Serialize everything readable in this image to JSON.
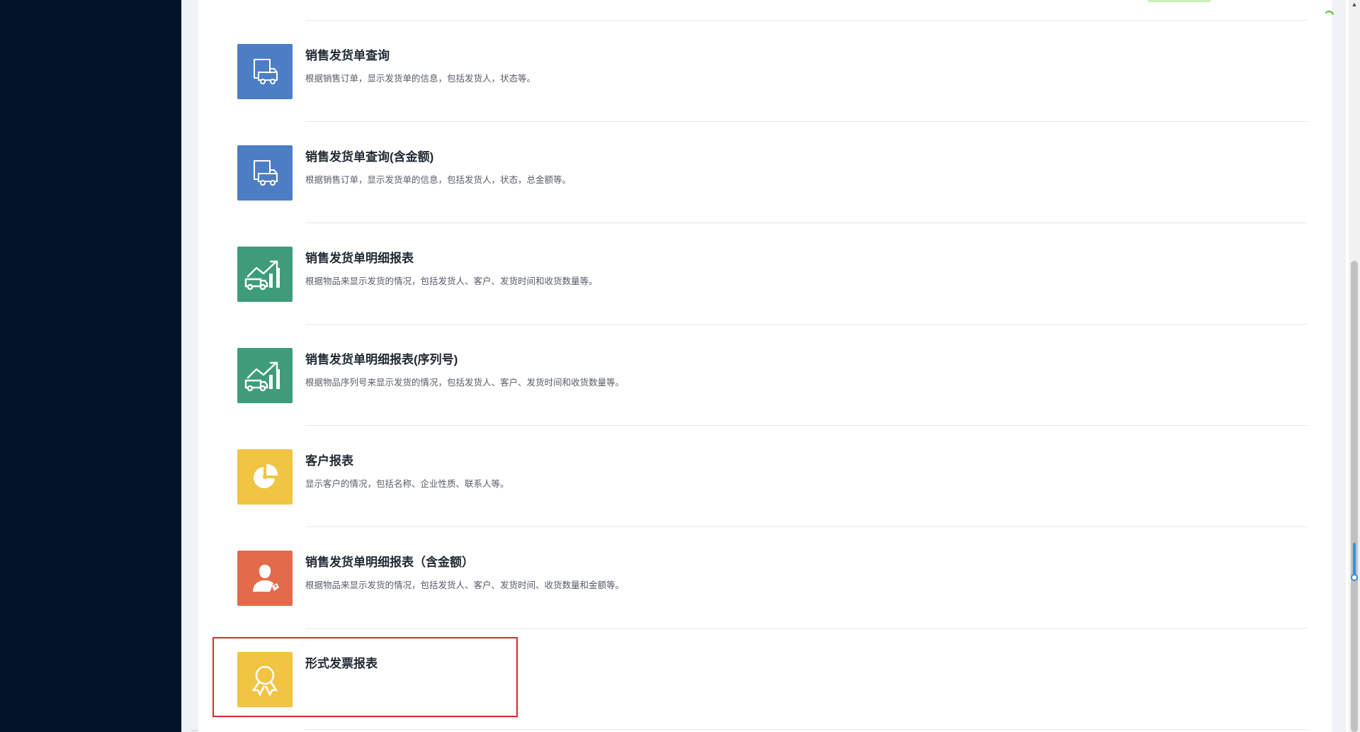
{
  "reports": [
    {
      "title": "销售发货单查询",
      "description": "根据销售订单，显示发货单的信息，包括发货人，状态等。",
      "icon": "delivery-truck-icon",
      "color": "#4d7ec5"
    },
    {
      "title": "销售发货单查询(含金额)",
      "description": "根据销售订单，显示发货单的信息，包括发货人，状态，总金额等。",
      "icon": "delivery-truck-icon",
      "color": "#4d7ec5"
    },
    {
      "title": "销售发货单明细报表",
      "description": "根据物品来显示发货的情况，包括发货人、客户、发货时间和收货数量等。",
      "icon": "truck-growth-chart-icon",
      "color": "#3f9c7a"
    },
    {
      "title": "销售发货单明细报表(序列号)",
      "description": "根据物品序列号来显示发货的情况，包括发货人、客户、发货时间和收货数量等。",
      "icon": "truck-growth-chart-icon",
      "color": "#3f9c7a"
    },
    {
      "title": "客户报表",
      "description": "显示客户的情况，包括名称、企业性质、联系人等。",
      "icon": "pie-chart-icon",
      "color": "#f1c443"
    },
    {
      "title": "销售发货单明细报表（含金额）",
      "description": "根据物品来显示发货的情况，包括发货人、客户、发货时间、收货数量和金额等。",
      "icon": "user-tag-icon",
      "color": "#e46a4c"
    },
    {
      "title": "形式发票报表",
      "description": "",
      "icon": "award-ribbon-icon",
      "color": "#f1c443"
    }
  ],
  "colors": {
    "sidebar": "#021429",
    "highlight": "#e2252c",
    "title": "#222a33",
    "description": "#555d66"
  }
}
